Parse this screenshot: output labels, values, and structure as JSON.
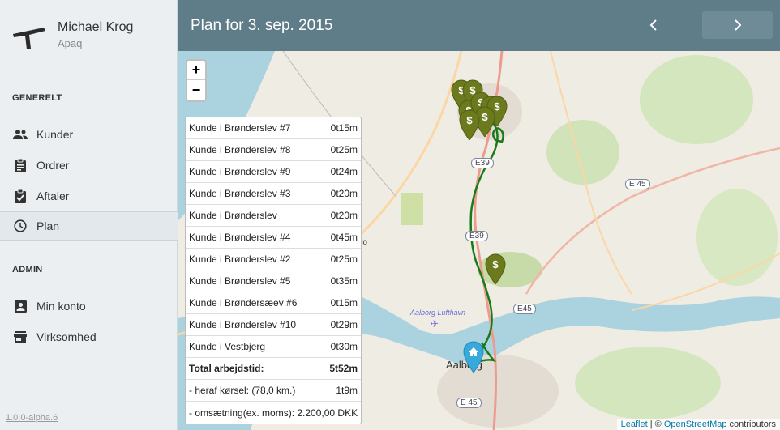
{
  "user": {
    "name": "Michael Krog",
    "company": "Apaq"
  },
  "sidebar": {
    "general_title": "GENERELT",
    "general_items": [
      {
        "label": "Kunder",
        "icon": "people-icon"
      },
      {
        "label": "Ordrer",
        "icon": "clipboard-icon"
      },
      {
        "label": "Aftaler",
        "icon": "clipboard-check-icon"
      },
      {
        "label": "Plan",
        "icon": "clock-icon",
        "active": true
      }
    ],
    "admin_title": "ADMIN",
    "admin_items": [
      {
        "label": "Min konto",
        "icon": "account-box-icon"
      },
      {
        "label": "Virksomhed",
        "icon": "store-icon"
      }
    ],
    "version": "1.0.0-alpha.6"
  },
  "header": {
    "title": "Plan for 3. sep. 2015"
  },
  "map": {
    "zoom_in": "+",
    "zoom_out": "−",
    "attribution": {
      "leaflet": "Leaflet",
      "sep": " | © ",
      "osm": "OpenStreetMap",
      "suffix": " contributors"
    },
    "labels": {
      "e39_a": "E39",
      "e39_b": "E39",
      "e45_a": "E 45",
      "e45_b": "E45",
      "e45_c": "E 45",
      "airport": "Aalborg Lufthavn",
      "city": "Aalborg",
      "ro": "ro"
    },
    "route_color": "#1a7a1a",
    "marker_color": "#6b7a1c"
  },
  "plan": {
    "rows": [
      {
        "name": "Kunde i Brønderslev #7",
        "duration": "0t15m"
      },
      {
        "name": "Kunde i Brønderslev #8",
        "duration": "0t25m"
      },
      {
        "name": "Kunde i Brønderslev #9",
        "duration": "0t24m"
      },
      {
        "name": "Kunde i Brønderslev #3",
        "duration": "0t20m"
      },
      {
        "name": "Kunde i Brønderslev",
        "duration": "0t20m"
      },
      {
        "name": "Kunde i Brønderslev #4",
        "duration": "0t45m"
      },
      {
        "name": "Kunde i Brønderslev #2",
        "duration": "0t25m"
      },
      {
        "name": "Kunde i Brønderslev #5",
        "duration": "0t35m"
      },
      {
        "name": "Kunde i Brøndersæev #6",
        "duration": "0t15m"
      },
      {
        "name": "Kunde i Brønderslev #10",
        "duration": "0t29m"
      },
      {
        "name": "Kunde i Vestbjerg",
        "duration": "0t30m"
      }
    ],
    "total": {
      "name": "Total arbejdstid:",
      "duration": "5t52m"
    },
    "driving": {
      "name": "- heraf kørsel: (78,0 km.)",
      "duration": "1t9m"
    },
    "revenue": {
      "name": "- omsætning(ex. moms): 2.200,00 DKK"
    }
  }
}
